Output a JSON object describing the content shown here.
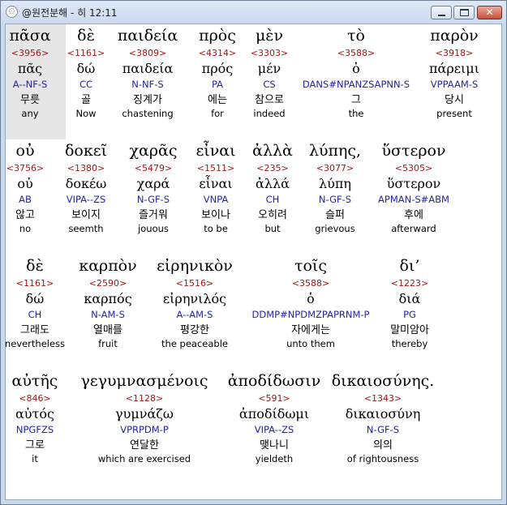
{
  "window": {
    "title": "@원전분해 - 히 12:11",
    "icon": "app-circle-icon",
    "controls": {
      "minimize": "",
      "maximize": "",
      "close": "✕"
    }
  },
  "rows": [
    {
      "words": [
        {
          "greek": "πᾶσα",
          "strongs": "<3956>",
          "lexeme": "πᾶς",
          "parsing": "A--NF-S",
          "korean": "무릇",
          "english": "any",
          "selected": true
        },
        {
          "greek": "δὲ",
          "strongs": "<1161>",
          "lexeme": "δώ",
          "parsing": "CC",
          "korean": "골",
          "english": "Now"
        },
        {
          "greek": "παιδεία",
          "strongs": "<3809>",
          "lexeme": "παιδεία",
          "parsing": "N-NF-S",
          "korean": "징계가",
          "english": "chastening"
        },
        {
          "greek": "πρὸς",
          "strongs": "<4314>",
          "lexeme": "πρός",
          "parsing": "PA",
          "korean": "에는",
          "english": "for"
        },
        {
          "greek": "μὲν",
          "strongs": "<3303>",
          "lexeme": "μέν",
          "parsing": "CS",
          "korean": "참으로",
          "english": "indeed"
        },
        {
          "greek": "τὸ",
          "strongs": "<3588>",
          "lexeme": "ὁ",
          "parsing": "DANS#NPANZSAPNN-S",
          "korean": "그",
          "english": "the"
        },
        {
          "greek": "παρὸν",
          "strongs": "<3918>",
          "lexeme": "πάρειμι",
          "parsing": "VPPAAM-S",
          "korean": "당시",
          "english": "present"
        }
      ]
    },
    {
      "words": [
        {
          "greek": "οὐ",
          "strongs": "<3756>",
          "lexeme": "οὐ",
          "parsing": "AB",
          "korean": "않고",
          "english": "no"
        },
        {
          "greek": "δοκεῖ",
          "strongs": "<1380>",
          "lexeme": "δοκέω",
          "parsing": "VIPA--ZS",
          "korean": "보이지",
          "english": "seemth"
        },
        {
          "greek": "χαρᾶς",
          "strongs": "<5479>",
          "lexeme": "χαρά",
          "parsing": "N-GF-S",
          "korean": "즐거워",
          "english": "jouous"
        },
        {
          "greek": "εἶναι",
          "strongs": "<1511>",
          "lexeme": "εἶναι",
          "parsing": "VNPA",
          "korean": "보이나",
          "english": "to be"
        },
        {
          "greek": "ἀλλὰ",
          "strongs": "<235>",
          "lexeme": "ἀλλά",
          "parsing": "CH",
          "korean": "오히려",
          "english": "but"
        },
        {
          "greek": "λύπης,",
          "strongs": "<3077>",
          "lexeme": "λύπη",
          "parsing": "N-GF-S",
          "korean": "슬퍼",
          "english": "grievous"
        },
        {
          "greek": "ὕστερον",
          "strongs": "<5305>",
          "lexeme": "ὕστερον",
          "parsing": "APMAN-S#ABM",
          "korean": "후에",
          "english": "afterward"
        }
      ]
    },
    {
      "words": [
        {
          "greek": "δὲ",
          "strongs": "<1161>",
          "lexeme": "δώ",
          "parsing": "CH",
          "korean": "그래도",
          "english": "nevertheless"
        },
        {
          "greek": "καρπὸν",
          "strongs": "<2590>",
          "lexeme": "καρπός",
          "parsing": "N-AM-S",
          "korean": "열매를",
          "english": "fruit"
        },
        {
          "greek": "εἰρηνικὸν",
          "strongs": "<1516>",
          "lexeme": "εἰρηνιλός",
          "parsing": "A--AM-S",
          "korean": "평강한",
          "english": "the peaceable"
        },
        {
          "greek": "τοῖς",
          "strongs": "<3588>",
          "lexeme": "ὁ",
          "parsing": "DDMP#NPDMZPAPRNM-P",
          "korean": "자에게는",
          "english": "unto them"
        },
        {
          "greek": "δι’",
          "strongs": "<1223>",
          "lexeme": "διά",
          "parsing": "PG",
          "korean": "말미암아",
          "english": "thereby"
        }
      ]
    },
    {
      "words": [
        {
          "greek": "αὐτῆς",
          "strongs": "<846>",
          "lexeme": "αὐτός",
          "parsing": "NPGFZS",
          "korean": "그로",
          "english": "it"
        },
        {
          "greek": "γεγυμνασμένοις",
          "strongs": "<1128>",
          "lexeme": "γυμνάζω",
          "parsing": "VPRPDM-P",
          "korean": "연달한",
          "english": "which are exercised"
        },
        {
          "greek": "ἀποδίδωσιν",
          "strongs": "<591>",
          "lexeme": "ἀποδίδωμι",
          "parsing": "VIPA--ZS",
          "korean": "맺나니",
          "english": "yieldeth"
        },
        {
          "greek": "δικαιοσύνης.",
          "strongs": "<1343>",
          "lexeme": "δικαιοσύνη",
          "parsing": "N-GF-S",
          "korean": "의의",
          "english": "of rightousness"
        }
      ]
    }
  ],
  "colors": {
    "strongs": "#a01818",
    "parsing": "#2323a8",
    "selection": "#e6e6e6"
  }
}
